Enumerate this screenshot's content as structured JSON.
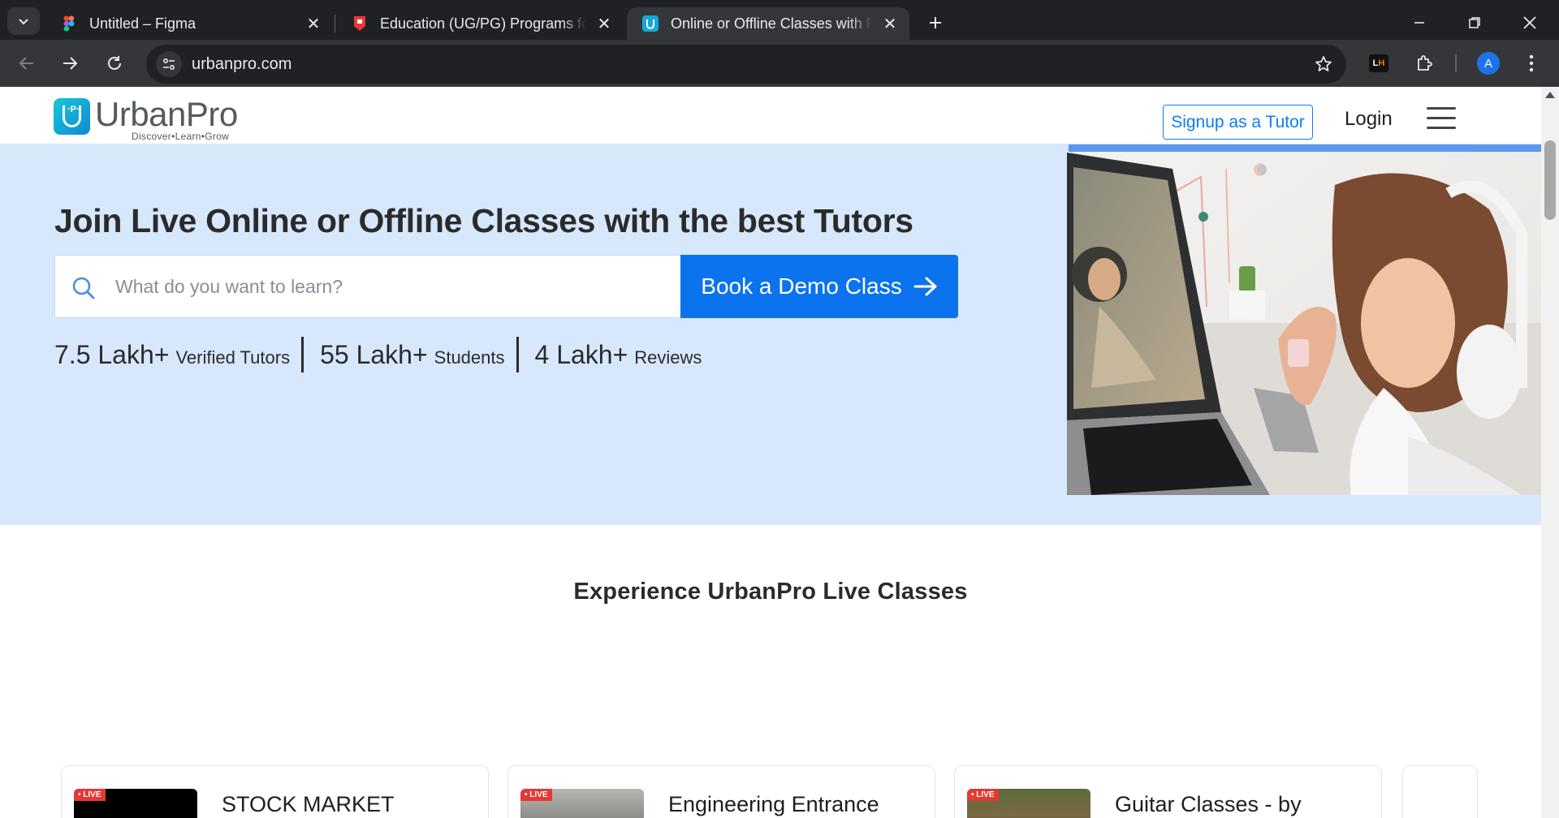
{
  "browser": {
    "tabs": [
      {
        "title": "Untitled – Figma",
        "active": false
      },
      {
        "title": "Education (UG/PG) Programs fo",
        "active": false
      },
      {
        "title": "Online or Offline Classes with Pe",
        "active": true
      }
    ],
    "url": "urbanpro.com",
    "profile_initial": "A",
    "extension_lh": {
      "l": "L",
      "h": "H"
    }
  },
  "site": {
    "logo": {
      "name": "UrbanPro",
      "tagline": "Discover•Learn•Grow",
      "mark": "·P·"
    },
    "header": {
      "signup_label": "Signup as a Tutor",
      "login_label": "Login"
    },
    "hero": {
      "title": "Join Live Online or Offline Classes with the best Tutors",
      "search_placeholder": "What do you want to learn?",
      "cta_label": "Book a Demo Class",
      "stats": [
        {
          "value": "7.5 Lakh+",
          "label": "Verified Tutors"
        },
        {
          "value": "55 Lakh+",
          "label": "Students"
        },
        {
          "value": "4 Lakh+",
          "label": "Reviews"
        }
      ]
    },
    "live_section": {
      "title": "Experience UrbanPro Live Classes",
      "live_badge": "• LIVE",
      "cards": [
        {
          "title": "STOCK MARKET"
        },
        {
          "title": "Engineering Entrance"
        },
        {
          "title": "Guitar Classes - by"
        }
      ]
    }
  },
  "colors": {
    "brand_blue": "#0c73ee",
    "hero_bg": "#d7e8fc",
    "chrome_dark": "#202124",
    "chrome_toolbar": "#35363a"
  }
}
